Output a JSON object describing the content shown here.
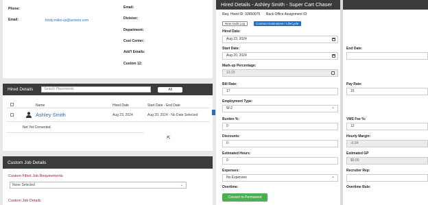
{
  "contact": {
    "phone_label": "Phone:",
    "email_label": "Email:",
    "email_value": "kristy.miller+js@avionte.com",
    "right_labels": [
      "Email:",
      "Division:",
      "Department:",
      "Cost Center:",
      "Add'l Emails:",
      "Custom 12:"
    ]
  },
  "hired": {
    "title": "Hired Details",
    "search_placeholder": "Search Placements",
    "all_label": "All",
    "columns": {
      "name": "Name",
      "hired_date": "Hired Date",
      "start_end": "Start Date - End Date"
    },
    "row": {
      "name": "Ashley Smith",
      "hired_date": "Aug 23, 2024",
      "start_end": "Aug 20, 2024 - No Date Selected",
      "status": "Not Yet Converted."
    }
  },
  "job": {
    "title": "Custom Job Details",
    "filled_label": "Custom Filled Job Requirements",
    "filled_value": "None Selected",
    "details_label": "Custom Job Details"
  },
  "modal": {
    "title": "Hired Details - Ashley Smith - Super Cart Chaser",
    "req_hired_id": "Req. Hired ID: 93650075",
    "back_office": "Back Office Assignment ID:",
    "audit_btn": "New Audit Log",
    "ext_btn": "Contract Extensions / LifeCycle",
    "hired_date_label": "Hired Date:",
    "hired_date_value": "Aug 23, 2024",
    "start_date_label": "Start Date:",
    "start_date_value": "Aug 20, 2024",
    "end_date_label": "End Date:",
    "markup_label": "Mark-up Percentage:",
    "markup_value": "13.33",
    "bill_rate_label": "Bill Rate:",
    "bill_rate_value": "17",
    "pay_rate_label": "Pay Rate:",
    "pay_rate_value": "15",
    "emp_type_label": "Employment Type:",
    "emp_type_value": "W-2",
    "burden_label": "Burden %:",
    "burden_value": "0",
    "vms_label": "VMS Fee %:",
    "vms_value": "12",
    "discounts_label": "Discounts:",
    "discounts_value": "0",
    "hourly_margin_label": "Hourly Margin:",
    "hourly_margin_value": "-0.04",
    "est_hours_label": "Estimated Hours:",
    "est_hours_value": "0",
    "est_gp_label": "Estimated GP",
    "est_gp_value": "$0.00",
    "expenses_label": "Expenses:",
    "expenses_value": "No Expenses",
    "recruiter_label": "Recruiter Rep:",
    "overtime_label": "Overtime:",
    "overtime_rule_label": "Overtime Rule:",
    "convert_btn": "Convert to Permanent"
  }
}
